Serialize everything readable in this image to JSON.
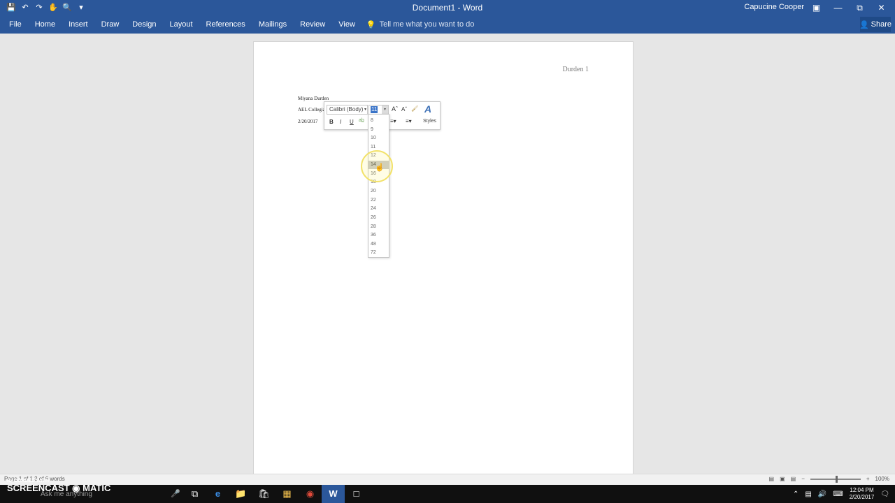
{
  "window": {
    "title": "Document1 - Word",
    "user": "Capucine Cooper",
    "controls": [
      "ribbon-options-icon",
      "minimize-icon",
      "restore-icon",
      "close-icon"
    ]
  },
  "qat_icons": [
    "save-icon",
    "undo-icon",
    "redo-icon",
    "touch-mode-icon",
    "print-preview-icon",
    "customize-icon"
  ],
  "ribbon": {
    "tabs": [
      "File",
      "Home",
      "Insert",
      "Draw",
      "Design",
      "Layout",
      "References",
      "Mailings",
      "Review",
      "View"
    ],
    "tell_me": "Tell me what you want to do",
    "share": "Share"
  },
  "document": {
    "header": "Durden 1",
    "lines": [
      "Miyana Durden",
      "AEL Collegiat",
      "2/20/2017"
    ]
  },
  "mini_toolbar": {
    "font": "Calibri (Body)",
    "size": "11",
    "buttons": [
      "B",
      "I",
      "U"
    ],
    "styles": "Styles"
  },
  "font_sizes": [
    "8",
    "9",
    "10",
    "11",
    "12",
    "14",
    "16",
    "18",
    "20",
    "22",
    "24",
    "26",
    "28",
    "36",
    "48",
    "72"
  ],
  "font_size_hover": "14",
  "statusbar": {
    "left": "Page 1 of 1   3 of 6 words",
    "zoom": "100%"
  },
  "taskbar": {
    "watermark": "SCREENCAST ◉ MATIC",
    "recorded": "RECORDED WITH",
    "search_placeholder": "Ask me anything",
    "time": "12:04 PM",
    "date": "2/20/2017"
  },
  "colors": {
    "ribbon": "#2b579a",
    "taskbar": "#101010",
    "highlight": "#c5c5c5"
  }
}
